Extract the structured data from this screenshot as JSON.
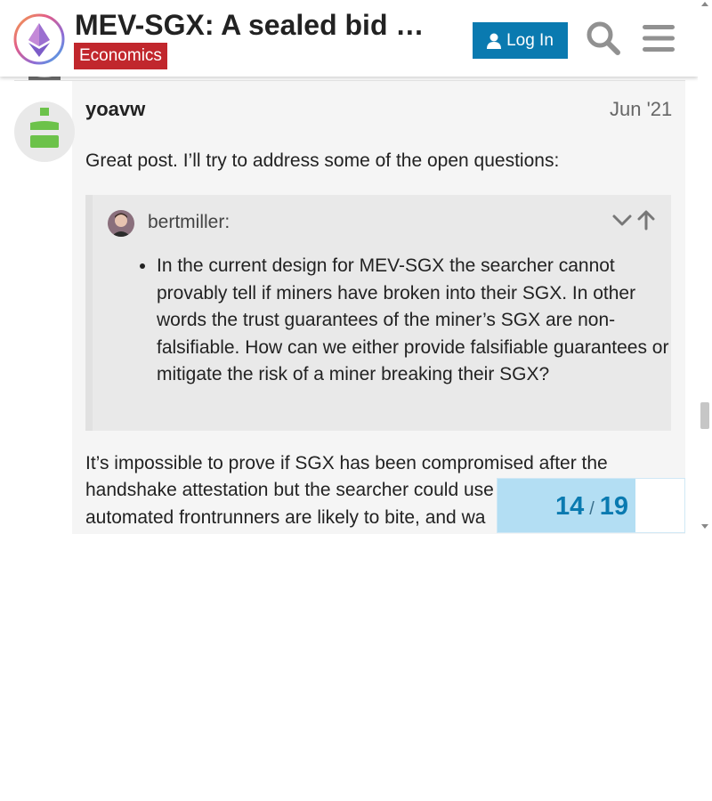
{
  "header": {
    "title": "MEV-SGX: A sealed bid …",
    "category": "Economics",
    "login_label": "Log In",
    "search_icon": "search-icon",
    "menu_icon": "hamburger-menu-icon"
  },
  "post": {
    "username": "yoavw",
    "date": "Jun '21",
    "intro": "Great post. I’ll try to address some of the open questions:",
    "quote": {
      "author": "bertmiller:",
      "items": [
        "In the current design for MEV-SGX the searcher cannot provably tell if miners have broken into their SGX. In other words the trust guarantees of the miner’s SGX are non-falsifiable. How can we either provide falsifiable guarantees or mitigate the risk of a miner breaking their SGX?"
      ]
    },
    "body_lines": [
      "It’s impossible to prove if SGX has been compromised after the",
      "handshake attestation but the searcher could use",
      "automated frontrunners are likely to bite, and wa"
    ]
  },
  "progress": {
    "current": "14",
    "separator": "/",
    "total": "19",
    "fraction": 0.7368
  },
  "colors": {
    "accent": "#0a7ab0",
    "category": "#c1272d",
    "avatar_green": "#6cc24a",
    "progress_fill": "#b3def3"
  }
}
